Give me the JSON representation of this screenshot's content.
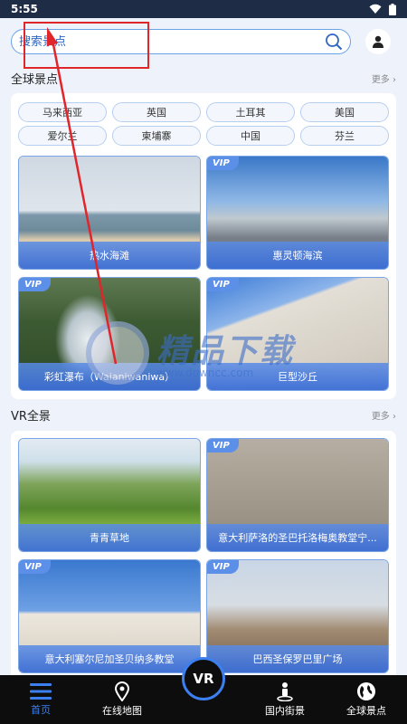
{
  "status_bar": {
    "time": "5:55"
  },
  "search": {
    "placeholder": "搜索景点"
  },
  "sections": {
    "global": {
      "title": "全球景点",
      "more": "更多 ›"
    },
    "vr": {
      "title": "VR全景",
      "more": "更多 ›"
    }
  },
  "countries": [
    "马来西亚",
    "英国",
    "土耳其",
    "美国",
    "爱尔兰",
    "柬埔寨",
    "中国",
    "芬兰"
  ],
  "global_tiles": [
    {
      "caption": "热水海滩",
      "vip": ""
    },
    {
      "caption": "惠灵顿海滨",
      "vip": "VIP"
    },
    {
      "caption": "彩虹瀑布（Waianiwaniwa）",
      "vip": "VIP"
    },
    {
      "caption": "巨型沙丘",
      "vip": "VIP"
    }
  ],
  "vr_tiles": [
    {
      "caption": "青青草地",
      "vip": ""
    },
    {
      "caption": "意大利萨洛的圣巴托洛梅奥教堂宁...",
      "vip": "VIP"
    },
    {
      "caption": "意大利塞尔尼加圣贝纳多教堂",
      "vip": "VIP"
    },
    {
      "caption": "巴西圣保罗巴里广场",
      "vip": "VIP"
    }
  ],
  "watermark": {
    "text": "精品下载",
    "sub": "www.downcc.com"
  },
  "bottom_nav": {
    "home": "首页",
    "map": "在线地图",
    "vr": "VR",
    "domestic": "国内街景",
    "global": "全球景点"
  },
  "colors": {
    "accent": "#3c7ff0",
    "annotation": "#e0252b",
    "caption_bg": "#4f86e0"
  }
}
